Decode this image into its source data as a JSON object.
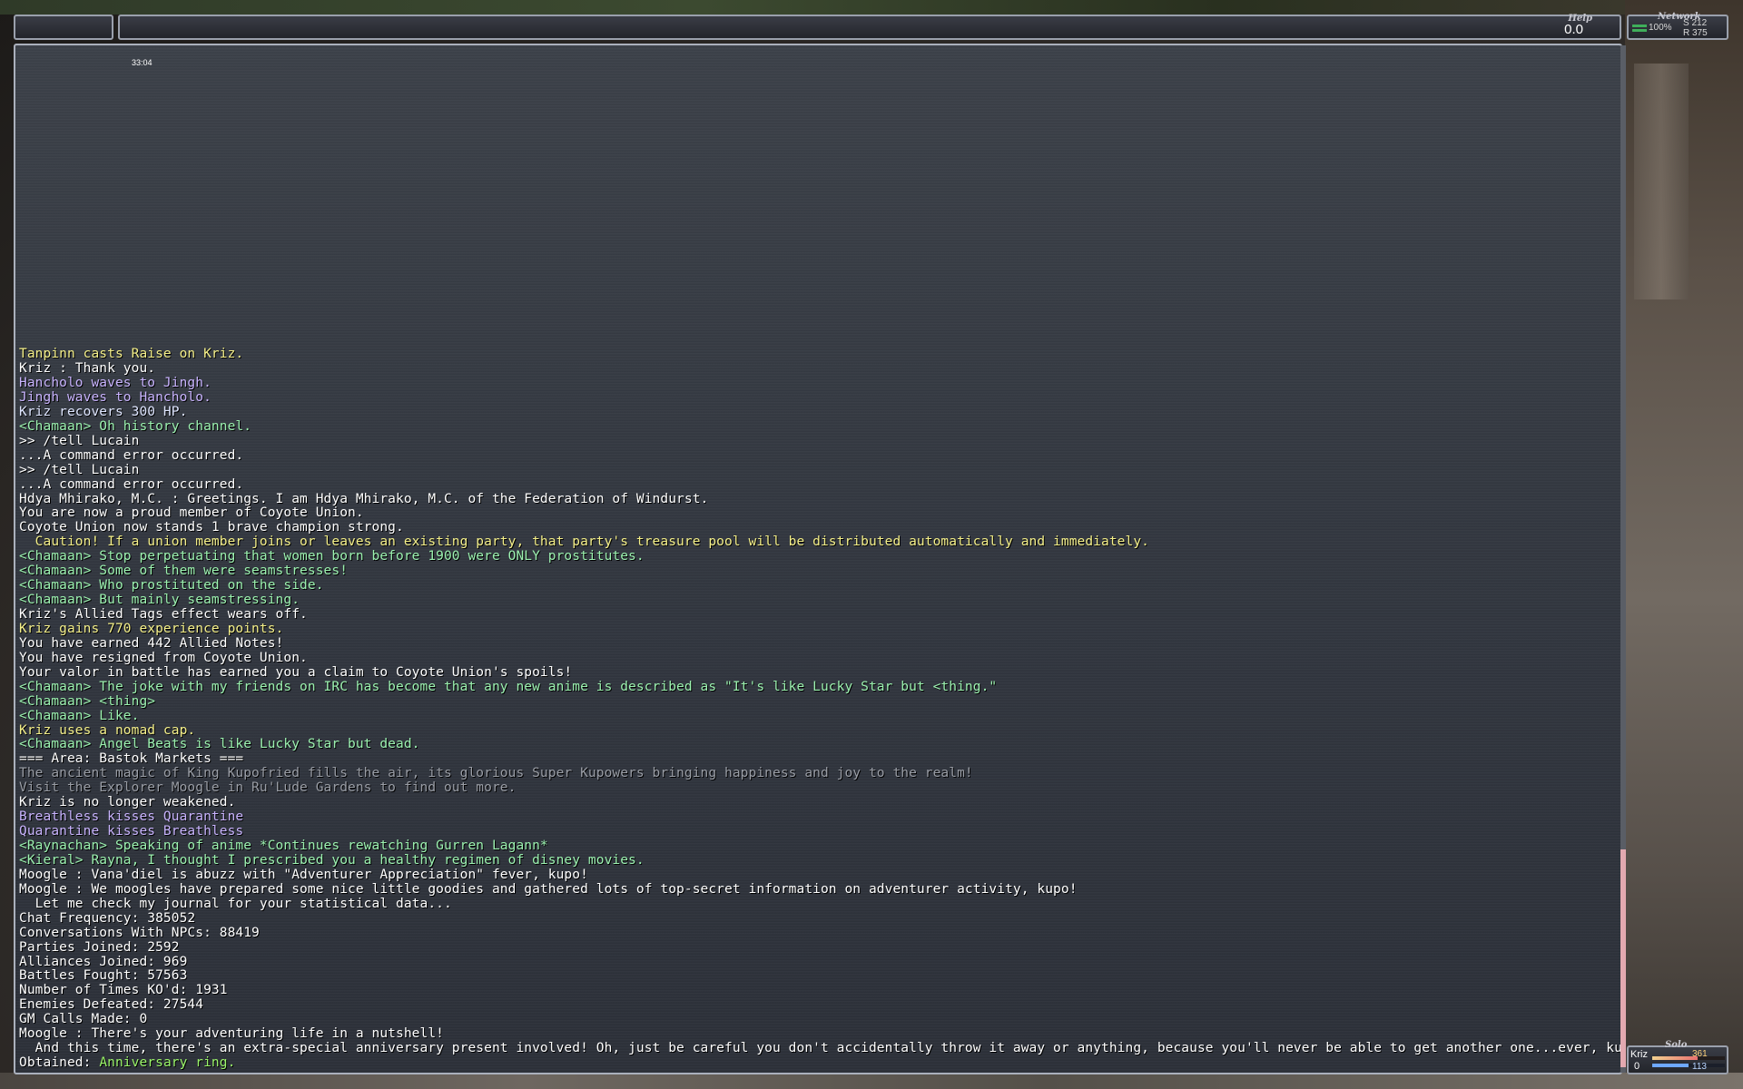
{
  "topbar": {
    "help_label": "Help",
    "help_value": "0.0"
  },
  "network": {
    "label": "Network",
    "percent": "100%",
    "s": "S 212",
    "r": "R 375"
  },
  "chat": {
    "timestamp": "33:04",
    "lines": [
      {
        "text": "Tanpinn casts Raise on Kriz.",
        "color": "yellow"
      },
      {
        "text": "Kriz : Thank you.",
        "color": "white",
        "hearts": true
      },
      {
        "text": "Hancholo waves to Jingh.",
        "color": "lav"
      },
      {
        "text": "Jingh waves to Hancholo.",
        "color": "lav"
      },
      {
        "text": "Kriz recovers 300 HP.",
        "color": "lblue"
      },
      {
        "text": "<Chamaan> Oh history channel.",
        "color": "green"
      },
      {
        "text": ">> /tell Lucain",
        "color": "white"
      },
      {
        "text": "...A command error occurred.",
        "color": "white"
      },
      {
        "text": ">> /tell Lucain",
        "color": "white"
      },
      {
        "text": "...A command error occurred.",
        "color": "white"
      },
      {
        "text": "Hdya Mhirako, M.C. : Greetings. I am Hdya Mhirako, M.C. of the Federation of Windurst.",
        "color": "white"
      },
      {
        "text": "You are now a proud member of Coyote Union.",
        "color": "white"
      },
      {
        "text": "Coyote Union now stands 1 brave champion strong.",
        "color": "white"
      },
      {
        "text": "  Caution! If a union member joins or leaves an existing party, that party's treasure pool will be distributed automatically and immediately.",
        "color": "yellow"
      },
      {
        "text": "<Chamaan> Stop perpetuating that women born before 1900 were ONLY prostitutes.",
        "color": "green"
      },
      {
        "text": "<Chamaan> Some of them were seamstresses!",
        "color": "green"
      },
      {
        "text": "<Chamaan> Who prostituted on the side.",
        "color": "green"
      },
      {
        "text": "<Chamaan> But mainly seamstressing.",
        "color": "green"
      },
      {
        "text": "Kriz's Allied Tags effect wears off.",
        "color": "white"
      },
      {
        "text": "Kriz gains 770 experience points.",
        "color": "yellow"
      },
      {
        "text": "You have earned 442 Allied Notes!",
        "color": "white"
      },
      {
        "text": "You have resigned from Coyote Union.",
        "color": "white"
      },
      {
        "text": "Your valor in battle has earned you a claim to Coyote Union's spoils!",
        "color": "white"
      },
      {
        "text": "<Chamaan> The joke with my friends on IRC has become that any new anime is described as \"It's like Lucky Star but <thing.\"",
        "color": "green"
      },
      {
        "text": "<Chamaan> <thing>",
        "color": "green"
      },
      {
        "text": "<Chamaan> Like.",
        "color": "green"
      },
      {
        "text": "Kriz uses a nomad cap.",
        "color": "yellow"
      },
      {
        "text": "<Chamaan> Angel Beats is like Lucky Star but dead.",
        "color": "green"
      },
      {
        "text": "=== Area: Bastok Markets ===",
        "color": "white"
      },
      {
        "text": "The ancient magic of King Kupofried fills the air, its glorious Super Kupowers bringing happiness and joy to the realm!",
        "color": "gray"
      },
      {
        "text": "Visit the Explorer Moogle in Ru'Lude Gardens to find out more.",
        "color": "gray"
      },
      {
        "text": "Kriz is no longer weakened.",
        "color": "white"
      },
      {
        "text": "Breathless kisses Quarantine",
        "color": "lav"
      },
      {
        "text": "Quarantine kisses Breathless",
        "color": "lav"
      },
      {
        "text": "<Raynachan> Speaking of anime *Continues rewatching Gurren Lagann*",
        "color": "green"
      },
      {
        "text": "<Kieral> Rayna, I thought I prescribed you a healthy regimen of disney movies.",
        "color": "green"
      },
      {
        "text": "Moogle : Vana'diel is abuzz with \"Adventurer Appreciation\" fever, kupo!",
        "color": "white"
      },
      {
        "text": "Moogle : We moogles have prepared some nice little goodies and gathered lots of top-secret information on adventurer activity, kupo!",
        "color": "white"
      },
      {
        "text": "  Let me check my journal for your statistical data...",
        "color": "white"
      },
      {
        "text": "Chat Frequency: 385052",
        "color": "white"
      },
      {
        "text": "Conversations With NPCs: 88419",
        "color": "white"
      },
      {
        "text": "Parties Joined: 2592",
        "color": "white"
      },
      {
        "text": "Alliances Joined: 969",
        "color": "white"
      },
      {
        "text": "Battles Fought: 57563",
        "color": "white"
      },
      {
        "text": "Number of Times KO'd: 1931",
        "color": "white"
      },
      {
        "text": "Enemies Defeated: 27544",
        "color": "white"
      },
      {
        "text": "GM Calls Made: 0",
        "color": "white"
      },
      {
        "text": "Moogle : There's your adventuring life in a nutshell!",
        "color": "white"
      },
      {
        "text": "  And this time, there's an extra-special anniversary present involved! Oh, just be careful you don't accidentally throw it away or anything, because you'll never be able to get another one...ever, kupo!",
        "color": "white"
      },
      {
        "text": "Obtained: ",
        "color": "white",
        "item": "Anniversary ring",
        "suffix": "."
      }
    ]
  },
  "party": {
    "mode_label": "Solo",
    "name": "Kriz",
    "tp": "0",
    "hp": "361",
    "mp": "113",
    "hp_fraction": 0.62,
    "mp_fraction": 0.5
  },
  "scroll": {
    "position_fraction": 1.0
  },
  "colors": {
    "yellow": "#f5f08a",
    "lav": "#c9b4ff",
    "green": "#9cf2b0",
    "gray": "#9a9ea6",
    "item": "#9bf56a",
    "white": "#ffffff"
  }
}
